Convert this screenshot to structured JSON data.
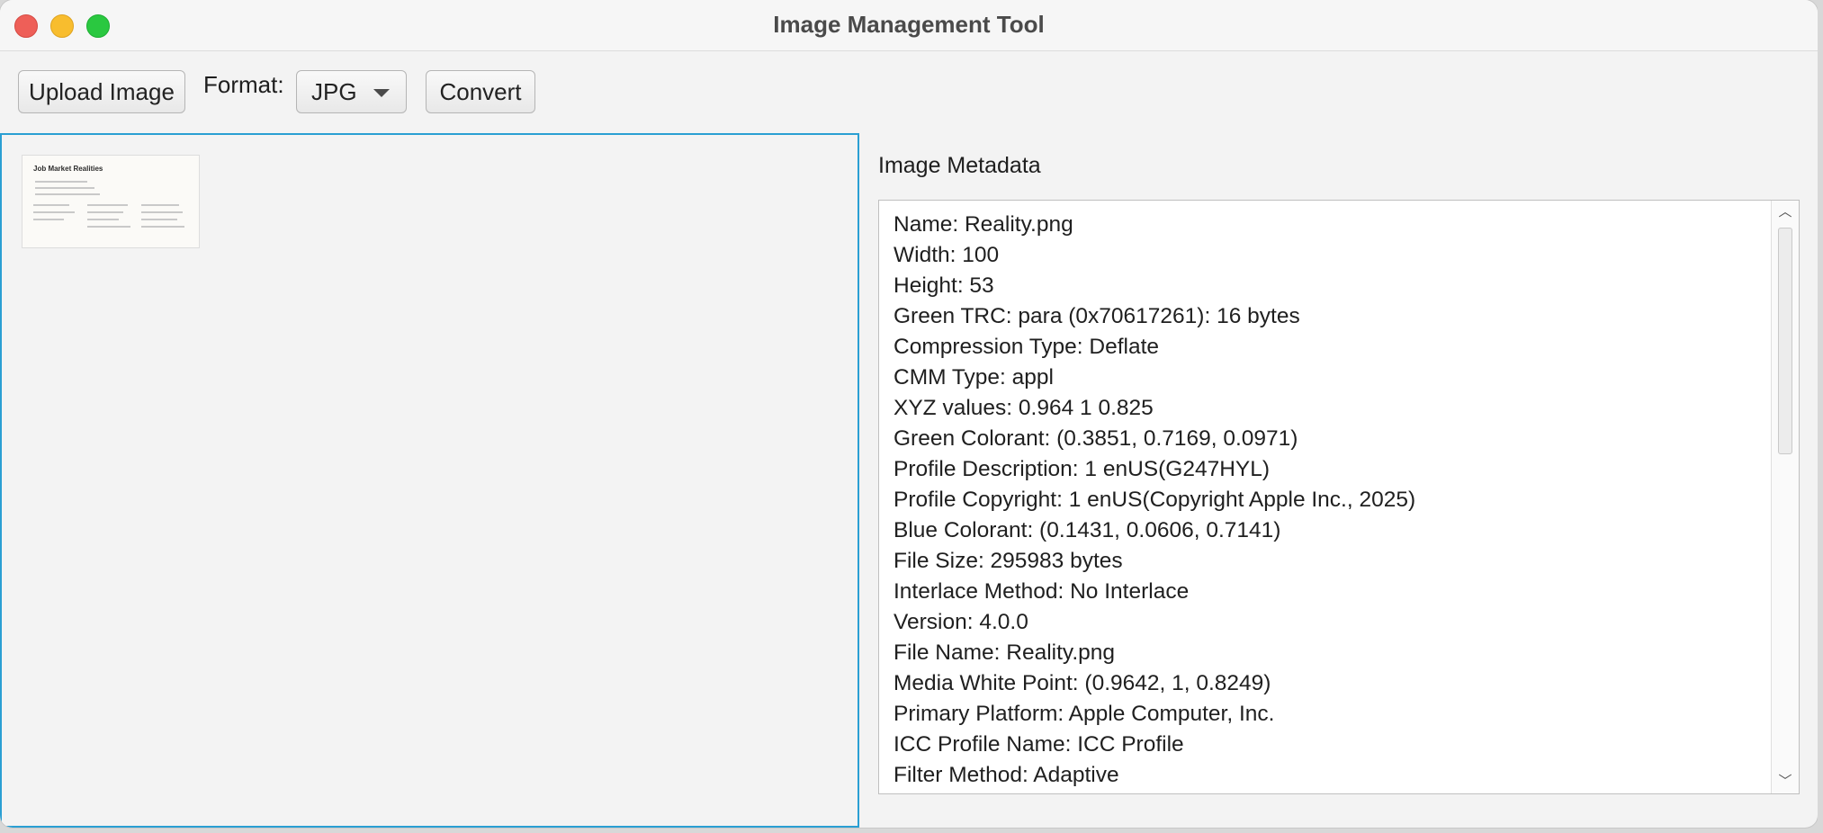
{
  "window": {
    "title": "Image Management Tool"
  },
  "toolbar": {
    "upload_label": "Upload Image",
    "format_label": "Format:",
    "format_selected": "JPG",
    "convert_label": "Convert"
  },
  "preview": {
    "thumbnail_title": "Job Market Realities"
  },
  "metadata": {
    "label": "Image Metadata",
    "lines": [
      "Name: Reality.png",
      "Width: 100",
      "Height: 53",
      "Green TRC: para (0x70617261): 16 bytes",
      "Compression Type: Deflate",
      "CMM Type: appl",
      "XYZ values: 0.964 1 0.825",
      "Green Colorant: (0.3851, 0.7169, 0.0971)",
      "Profile Description: 1 enUS(G247HYL)",
      "Profile Copyright: 1 enUS(Copyright Apple Inc., 2025)",
      "Blue Colorant: (0.1431, 0.0606, 0.7141)",
      "File Size: 295983 bytes",
      "Interlace Method: No Interlace",
      "Version: 4.0.0",
      "File Name: Reality.png",
      "Media White Point: (0.9642, 1, 0.8249)",
      "Primary Platform: Apple Computer, Inc.",
      "ICC Profile Name: ICC Profile",
      "Filter Method: Adaptive"
    ]
  },
  "icons": {
    "close": "close-icon",
    "minimize": "minimize-icon",
    "maximize": "maximize-icon",
    "dropdown": "chevron-down-icon",
    "scroll_up": "scroll-up-icon",
    "scroll_down": "scroll-down-icon"
  },
  "colors": {
    "selection_border": "#2a9fd3",
    "close": "#ee5f58",
    "minimize": "#f8bd2e",
    "maximize": "#2ac840"
  }
}
